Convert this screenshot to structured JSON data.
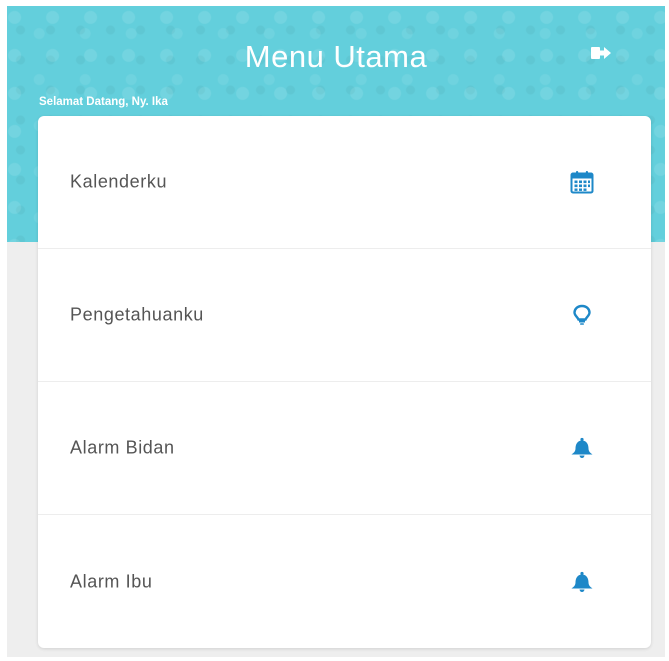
{
  "header": {
    "title": "Menu Utama",
    "welcome": "Selamat Datang, Ny. Ika",
    "logout_icon": "logout-icon"
  },
  "menu": {
    "items": [
      {
        "label": "Kalenderku",
        "icon": "calendar-icon"
      },
      {
        "label": "Pengetahuanku",
        "icon": "lightbulb-icon"
      },
      {
        "label": "Alarm Bidan",
        "icon": "bell-icon"
      },
      {
        "label": "Alarm Ibu",
        "icon": "bell-icon"
      }
    ]
  },
  "colors": {
    "header_bg": "#63cfdc",
    "icon_blue": "#1e88c8",
    "page_bg": "#eeeeee",
    "card_bg": "#ffffff"
  }
}
